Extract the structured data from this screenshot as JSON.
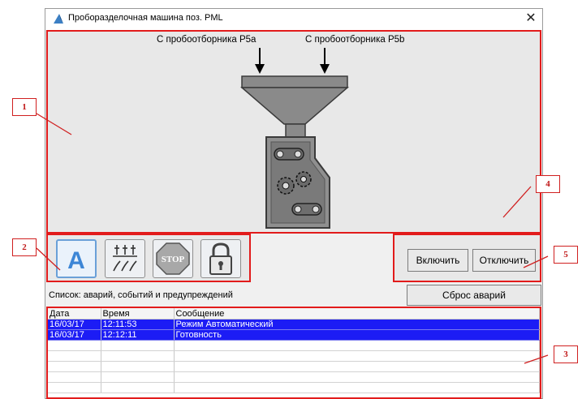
{
  "window": {
    "title": "Проборазделочная машина поз. PML",
    "close_glyph": "✕"
  },
  "machine": {
    "source_a": "С пробоотборника P5a",
    "source_b": "С пробоотборника P5b"
  },
  "mode_buttons": [
    {
      "icon": "auto-mode-icon",
      "glyph": "A"
    },
    {
      "icon": "switch-icon"
    },
    {
      "icon": "stop-icon",
      "glyph": "STOP"
    },
    {
      "icon": "lock-icon"
    }
  ],
  "controls": {
    "on_label": "Включить",
    "off_label": "Отключить",
    "reset_label": "Сброс аварий"
  },
  "alarm_list": {
    "caption": "Список: аварий, событий и предупреждений",
    "columns": [
      "Дата",
      "Время",
      "Сообщение"
    ],
    "rows": [
      {
        "date": "16/03/17",
        "time": "12:11:53",
        "message": "Режим Автоматический",
        "selected": true
      },
      {
        "date": "16/03/17",
        "time": "12:12:11",
        "message": "Готовность",
        "selected": true
      },
      {
        "date": "",
        "time": "",
        "message": "",
        "selected": false
      },
      {
        "date": "",
        "time": "",
        "message": "",
        "selected": false
      },
      {
        "date": "",
        "time": "",
        "message": "",
        "selected": false
      },
      {
        "date": "",
        "time": "",
        "message": "",
        "selected": false
      },
      {
        "date": "",
        "time": "",
        "message": "",
        "selected": false
      }
    ]
  },
  "callouts": [
    "1",
    "2",
    "3",
    "4",
    "5"
  ],
  "colors": {
    "highlight": "#e21b1b",
    "selection": "#1c1cf5"
  }
}
